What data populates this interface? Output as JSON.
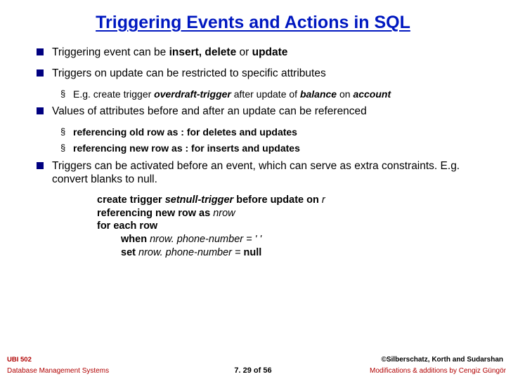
{
  "title": "Triggering Events and Actions in SQL",
  "bullets": {
    "b1": "Triggering event can be insert, delete or update",
    "b1_bold_start": "Triggering event can be ",
    "b1_bold_mid": "insert, delete ",
    "b1_rest": "or ",
    "b1_bold_end": "update",
    "b2": "Triggers on update can be restricted to specific attributes",
    "b2_sub_pre": "E.g.  create trigger ",
    "b2_sub_trigger": "overdraft-trigger ",
    "b2_sub_mid": "after update of ",
    "b2_sub_bal": "balance ",
    "b2_sub_on": "on ",
    "b2_sub_acct": "account",
    "b3": "Values of attributes before and after an update can be referenced",
    "b3_s1_pre": "referencing old row as",
    "b3_s1_post": "   : for deletes and updates",
    "b3_s2_pre": "referencing new row as",
    "b3_s2_post": "  : for inserts and updates",
    "b4": "Triggers can be activated before an event, which can serve as extra constraints.  E.g. convert blanks to null.",
    "code_l1_a": "create trigger ",
    "code_l1_b": "setnull-trigger ",
    "code_l1_c": "before update on ",
    "code_l1_d": "r",
    "code_l2_a": "referencing new row as ",
    "code_l2_b": "nrow",
    "code_l3": "for each row",
    "code_l4_a": "when ",
    "code_l4_b": "nrow. phone-number = ",
    "code_l4_c": "' '",
    "code_l5_a": "set ",
    "code_l5_b": "nrow. phone-number = ",
    "code_l5_c": "null"
  },
  "footer": {
    "left_top": "UBI 502",
    "left_bottom": "Database Management Systems",
    "center": "7. 29 of 56",
    "right_top": "©Silberschatz, Korth and Sudarshan",
    "right_bottom": "Modifications & additions by Cengiz Güngör"
  }
}
